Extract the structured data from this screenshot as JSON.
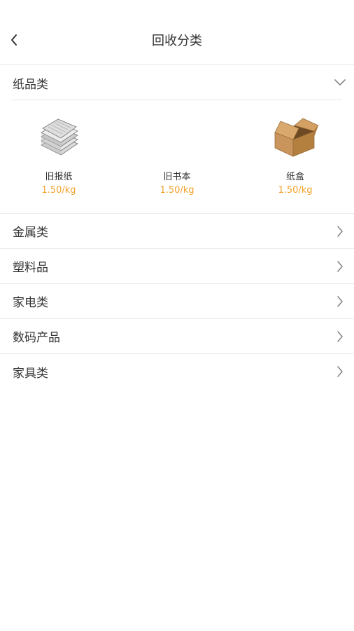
{
  "header": {
    "title": "回收分类"
  },
  "expanded_category": {
    "label": "纸品类",
    "items": [
      {
        "name": "旧报纸",
        "price": "1.50/kg"
      },
      {
        "name": "旧书本",
        "price": "1.50/kg"
      },
      {
        "name": "纸盒",
        "price": "1.50/kg"
      }
    ]
  },
  "categories": [
    {
      "label": "金属类"
    },
    {
      "label": "塑料品"
    },
    {
      "label": "家电类"
    },
    {
      "label": "数码产品"
    },
    {
      "label": "家具类"
    }
  ],
  "colors": {
    "price": "#f3a12b",
    "divider": "#ececec"
  },
  "icons": {
    "back": "chevron-left-icon",
    "expand": "chevron-down-icon",
    "row": "chevron-right-icon"
  }
}
